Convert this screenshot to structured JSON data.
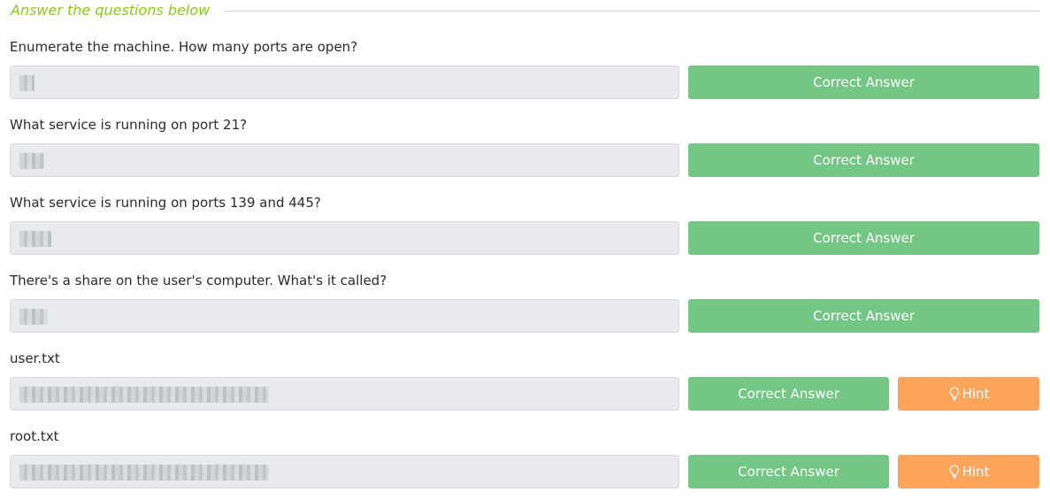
{
  "section": {
    "title": "Answer the questions below"
  },
  "buttons": {
    "correct_label": "Correct Answer",
    "hint_label": "Hint"
  },
  "questions": [
    {
      "text": "Enumerate the machine.  How many ports are open?",
      "has_hint": false
    },
    {
      "text": "What service is running on port 21?",
      "has_hint": false
    },
    {
      "text": "What service is running on ports 139 and 445?",
      "has_hint": false
    },
    {
      "text": "There's a share on the user's computer.  What's it called?",
      "has_hint": false
    },
    {
      "text": "user.txt",
      "has_hint": true
    },
    {
      "text": "root.txt",
      "has_hint": true
    }
  ],
  "colors": {
    "accent": "#88cc14",
    "correct_button": "#73c684",
    "hint_button": "#fca35c",
    "answer_field": "#e8eaed"
  }
}
